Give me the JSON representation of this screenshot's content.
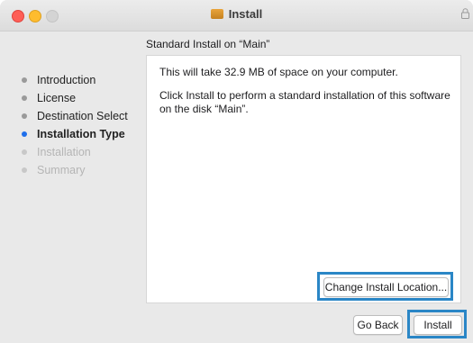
{
  "window": {
    "title": "Install",
    "traffic_lights": [
      "close",
      "minimize",
      "zoom-disabled"
    ]
  },
  "subtitle": "Standard Install on “Main”",
  "steps": [
    {
      "label": "Introduction",
      "state": "done"
    },
    {
      "label": "License",
      "state": "done"
    },
    {
      "label": "Destination Select",
      "state": "done"
    },
    {
      "label": "Installation Type",
      "state": "active"
    },
    {
      "label": "Installation",
      "state": "pending"
    },
    {
      "label": "Summary",
      "state": "pending"
    }
  ],
  "content": {
    "line1": "This will take 32.9 MB of space on your computer.",
    "line2": "Click Install to perform a standard installation of this software on the disk “Main”."
  },
  "buttons": {
    "change_location": "Change Install Location...",
    "go_back": "Go Back",
    "install": "Install"
  },
  "colors": {
    "active_step": "#1f6feb",
    "highlight": "#2a86c6",
    "close": "#fe5f57",
    "minimize": "#febc2e"
  }
}
